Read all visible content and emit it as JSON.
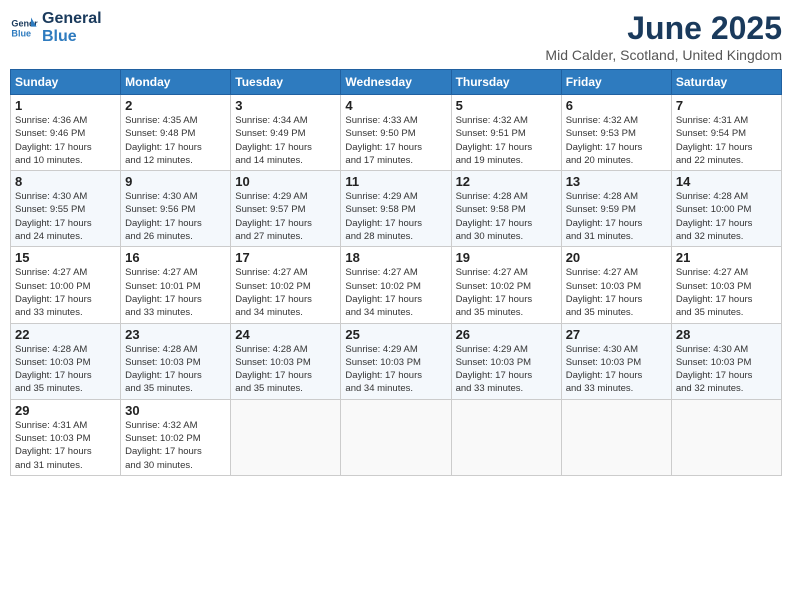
{
  "header": {
    "logo_line1": "General",
    "logo_line2": "Blue",
    "month": "June 2025",
    "location": "Mid Calder, Scotland, United Kingdom"
  },
  "weekdays": [
    "Sunday",
    "Monday",
    "Tuesday",
    "Wednesday",
    "Thursday",
    "Friday",
    "Saturday"
  ],
  "weeks": [
    [
      {
        "day": "1",
        "info": "Sunrise: 4:36 AM\nSunset: 9:46 PM\nDaylight: 17 hours\nand 10 minutes."
      },
      {
        "day": "2",
        "info": "Sunrise: 4:35 AM\nSunset: 9:48 PM\nDaylight: 17 hours\nand 12 minutes."
      },
      {
        "day": "3",
        "info": "Sunrise: 4:34 AM\nSunset: 9:49 PM\nDaylight: 17 hours\nand 14 minutes."
      },
      {
        "day": "4",
        "info": "Sunrise: 4:33 AM\nSunset: 9:50 PM\nDaylight: 17 hours\nand 17 minutes."
      },
      {
        "day": "5",
        "info": "Sunrise: 4:32 AM\nSunset: 9:51 PM\nDaylight: 17 hours\nand 19 minutes."
      },
      {
        "day": "6",
        "info": "Sunrise: 4:32 AM\nSunset: 9:53 PM\nDaylight: 17 hours\nand 20 minutes."
      },
      {
        "day": "7",
        "info": "Sunrise: 4:31 AM\nSunset: 9:54 PM\nDaylight: 17 hours\nand 22 minutes."
      }
    ],
    [
      {
        "day": "8",
        "info": "Sunrise: 4:30 AM\nSunset: 9:55 PM\nDaylight: 17 hours\nand 24 minutes."
      },
      {
        "day": "9",
        "info": "Sunrise: 4:30 AM\nSunset: 9:56 PM\nDaylight: 17 hours\nand 26 minutes."
      },
      {
        "day": "10",
        "info": "Sunrise: 4:29 AM\nSunset: 9:57 PM\nDaylight: 17 hours\nand 27 minutes."
      },
      {
        "day": "11",
        "info": "Sunrise: 4:29 AM\nSunset: 9:58 PM\nDaylight: 17 hours\nand 28 minutes."
      },
      {
        "day": "12",
        "info": "Sunrise: 4:28 AM\nSunset: 9:58 PM\nDaylight: 17 hours\nand 30 minutes."
      },
      {
        "day": "13",
        "info": "Sunrise: 4:28 AM\nSunset: 9:59 PM\nDaylight: 17 hours\nand 31 minutes."
      },
      {
        "day": "14",
        "info": "Sunrise: 4:28 AM\nSunset: 10:00 PM\nDaylight: 17 hours\nand 32 minutes."
      }
    ],
    [
      {
        "day": "15",
        "info": "Sunrise: 4:27 AM\nSunset: 10:00 PM\nDaylight: 17 hours\nand 33 minutes."
      },
      {
        "day": "16",
        "info": "Sunrise: 4:27 AM\nSunset: 10:01 PM\nDaylight: 17 hours\nand 33 minutes."
      },
      {
        "day": "17",
        "info": "Sunrise: 4:27 AM\nSunset: 10:02 PM\nDaylight: 17 hours\nand 34 minutes."
      },
      {
        "day": "18",
        "info": "Sunrise: 4:27 AM\nSunset: 10:02 PM\nDaylight: 17 hours\nand 34 minutes."
      },
      {
        "day": "19",
        "info": "Sunrise: 4:27 AM\nSunset: 10:02 PM\nDaylight: 17 hours\nand 35 minutes."
      },
      {
        "day": "20",
        "info": "Sunrise: 4:27 AM\nSunset: 10:03 PM\nDaylight: 17 hours\nand 35 minutes."
      },
      {
        "day": "21",
        "info": "Sunrise: 4:27 AM\nSunset: 10:03 PM\nDaylight: 17 hours\nand 35 minutes."
      }
    ],
    [
      {
        "day": "22",
        "info": "Sunrise: 4:28 AM\nSunset: 10:03 PM\nDaylight: 17 hours\nand 35 minutes."
      },
      {
        "day": "23",
        "info": "Sunrise: 4:28 AM\nSunset: 10:03 PM\nDaylight: 17 hours\nand 35 minutes."
      },
      {
        "day": "24",
        "info": "Sunrise: 4:28 AM\nSunset: 10:03 PM\nDaylight: 17 hours\nand 35 minutes."
      },
      {
        "day": "25",
        "info": "Sunrise: 4:29 AM\nSunset: 10:03 PM\nDaylight: 17 hours\nand 34 minutes."
      },
      {
        "day": "26",
        "info": "Sunrise: 4:29 AM\nSunset: 10:03 PM\nDaylight: 17 hours\nand 33 minutes."
      },
      {
        "day": "27",
        "info": "Sunrise: 4:30 AM\nSunset: 10:03 PM\nDaylight: 17 hours\nand 33 minutes."
      },
      {
        "day": "28",
        "info": "Sunrise: 4:30 AM\nSunset: 10:03 PM\nDaylight: 17 hours\nand 32 minutes."
      }
    ],
    [
      {
        "day": "29",
        "info": "Sunrise: 4:31 AM\nSunset: 10:03 PM\nDaylight: 17 hours\nand 31 minutes."
      },
      {
        "day": "30",
        "info": "Sunrise: 4:32 AM\nSunset: 10:02 PM\nDaylight: 17 hours\nand 30 minutes."
      },
      null,
      null,
      null,
      null,
      null
    ]
  ]
}
